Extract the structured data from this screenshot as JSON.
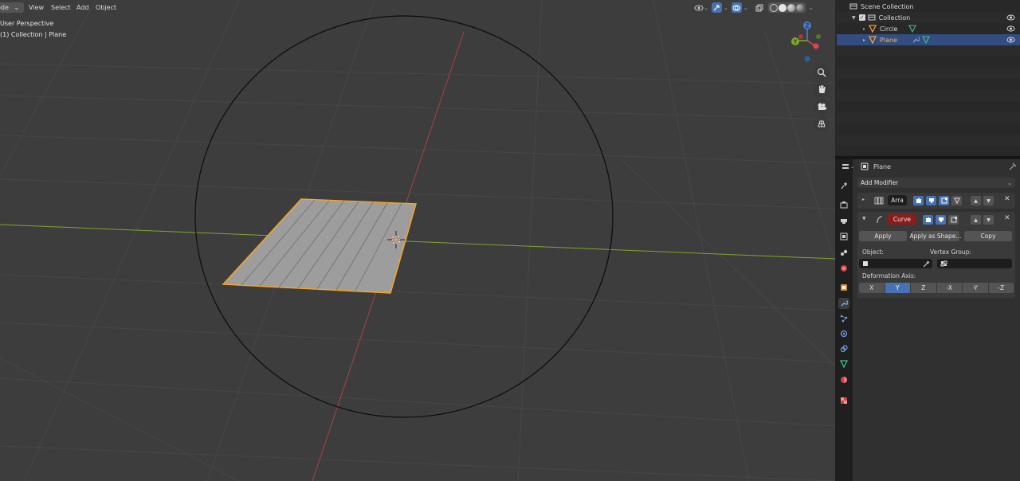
{
  "viewport": {
    "mode_label": "ode",
    "menus": [
      "View",
      "Select",
      "Add",
      "Object"
    ],
    "view_name": "User Perspective",
    "collection_info": "(1) Collection | Plane"
  },
  "gizmo": {
    "z": "Z",
    "y": "Y"
  },
  "outliner": {
    "scene_collection": "Scene Collection",
    "collection": "Collection",
    "objects": [
      {
        "name": "Circle",
        "selected": false
      },
      {
        "name": "Plane",
        "selected": true
      }
    ]
  },
  "properties": {
    "object_name": "Plane",
    "add_modifier": "Add Modifier",
    "modifiers": [
      {
        "name": "Arra",
        "expanded": false
      },
      {
        "name": "Curve",
        "expanded": true
      }
    ],
    "apply": "Apply",
    "apply_shape": "Apply as Shape...",
    "copy": "Copy",
    "object_label": "Object:",
    "vertex_group_label": "Vertex Group:",
    "deformation_axis_label": "Deformation Axis:",
    "axes": [
      "X",
      "Y",
      "Z",
      "-X",
      "-Y",
      "-Z"
    ],
    "selected_axis": "Y"
  },
  "colors": {
    "viewport_bg": "#3d3d3d",
    "selection_orange": "#f5a623",
    "accent_blue": "#4772b3",
    "x_axis_red": "#e0454f",
    "y_axis_green": "#7fa62b",
    "curve_modifier_red": "#8c1b1b"
  }
}
